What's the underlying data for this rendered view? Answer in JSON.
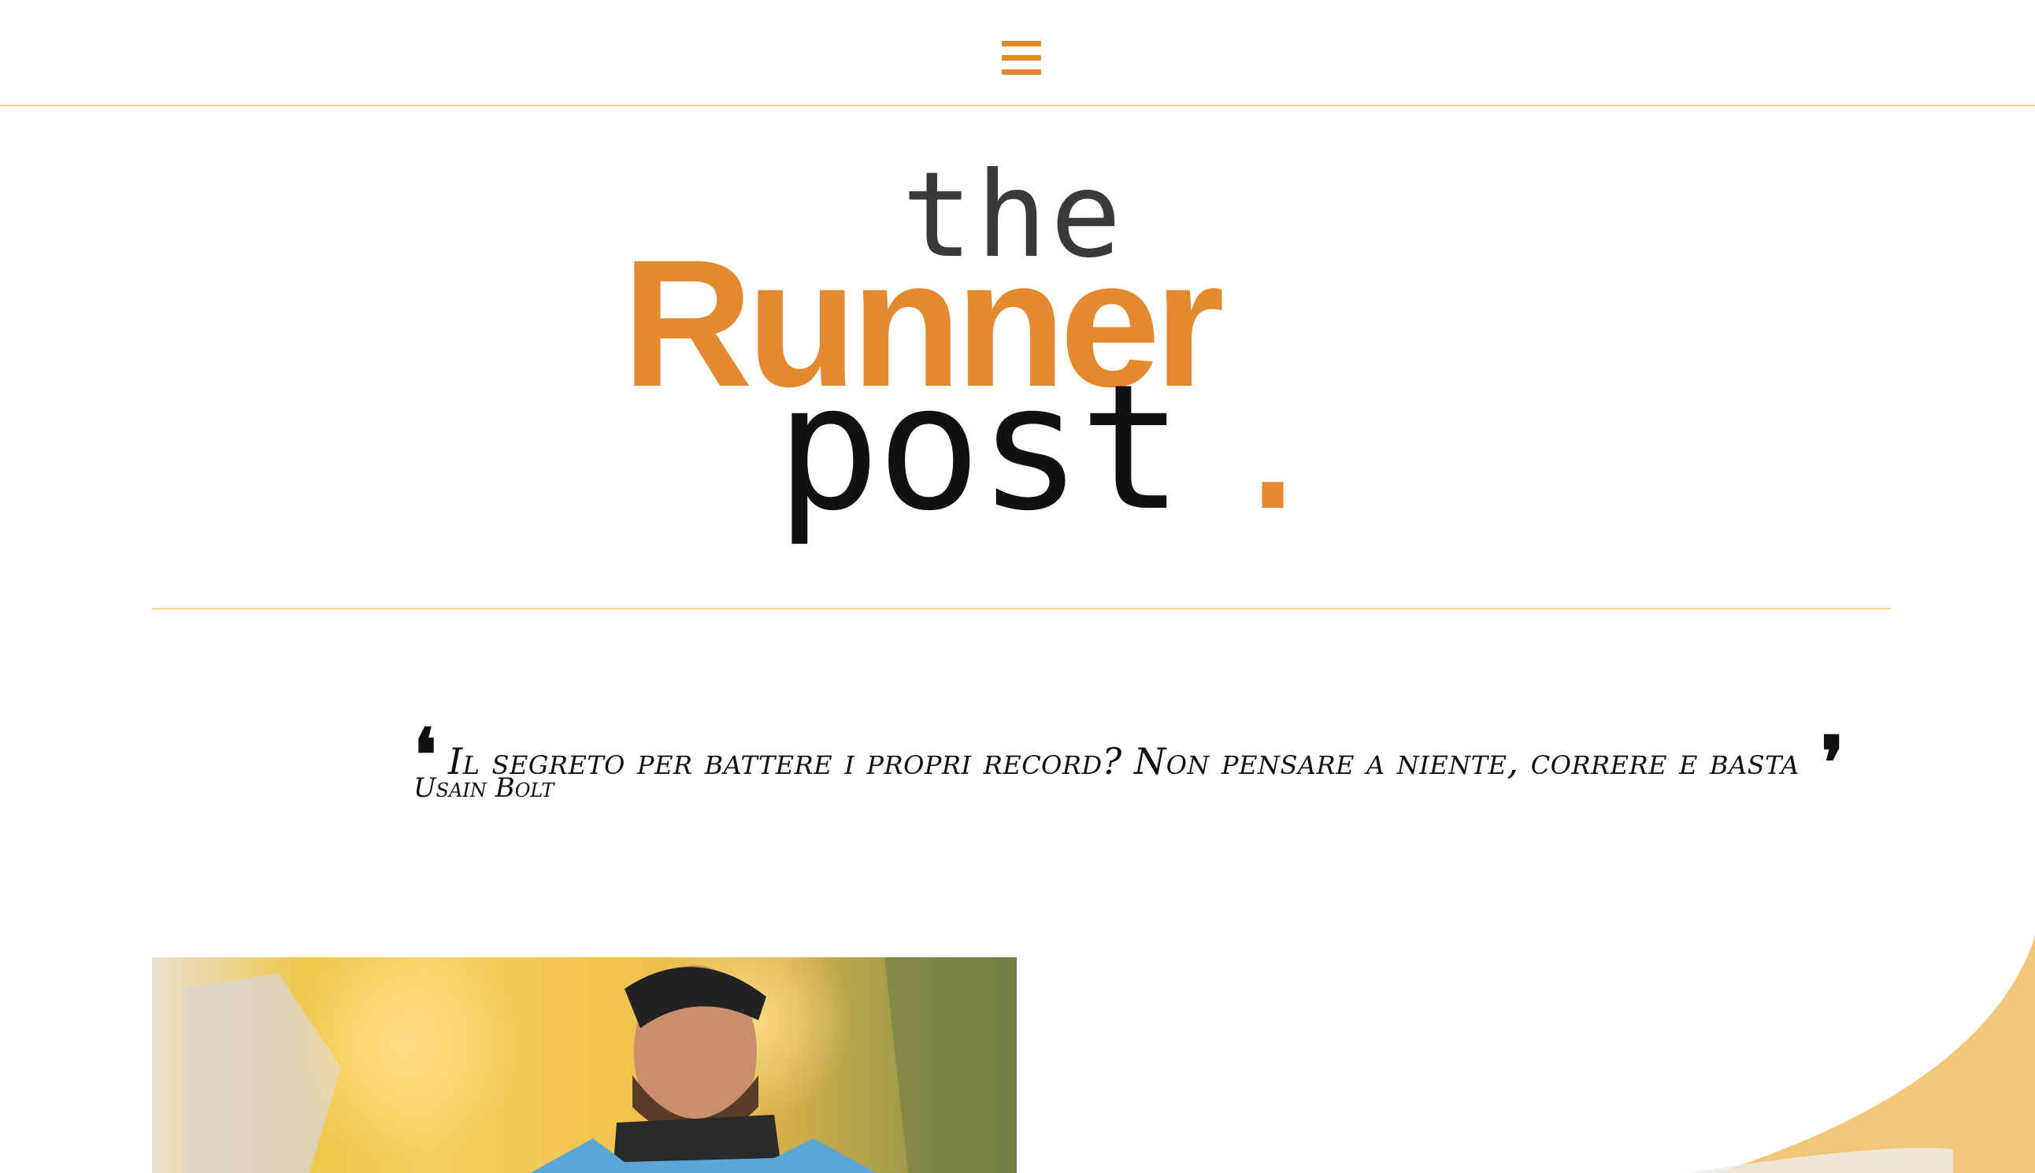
{
  "header": {
    "menu_icon": "hamburger-menu-icon"
  },
  "logo": {
    "word_the": "the",
    "word_runner": "Runner",
    "word_post": "post",
    "word_dot": ".",
    "accent_color": "#e5892e",
    "text_color": "#111111"
  },
  "quote": {
    "open_mark": "❛",
    "text": "Il segreto per battere i propri record? Non pensare a niente, correre e basta",
    "close_mark": "❜",
    "author": "Usain Bolt"
  },
  "colors": {
    "accent": "#e5892e",
    "divider": "#f0d48a",
    "corner": "#f3c77a"
  }
}
